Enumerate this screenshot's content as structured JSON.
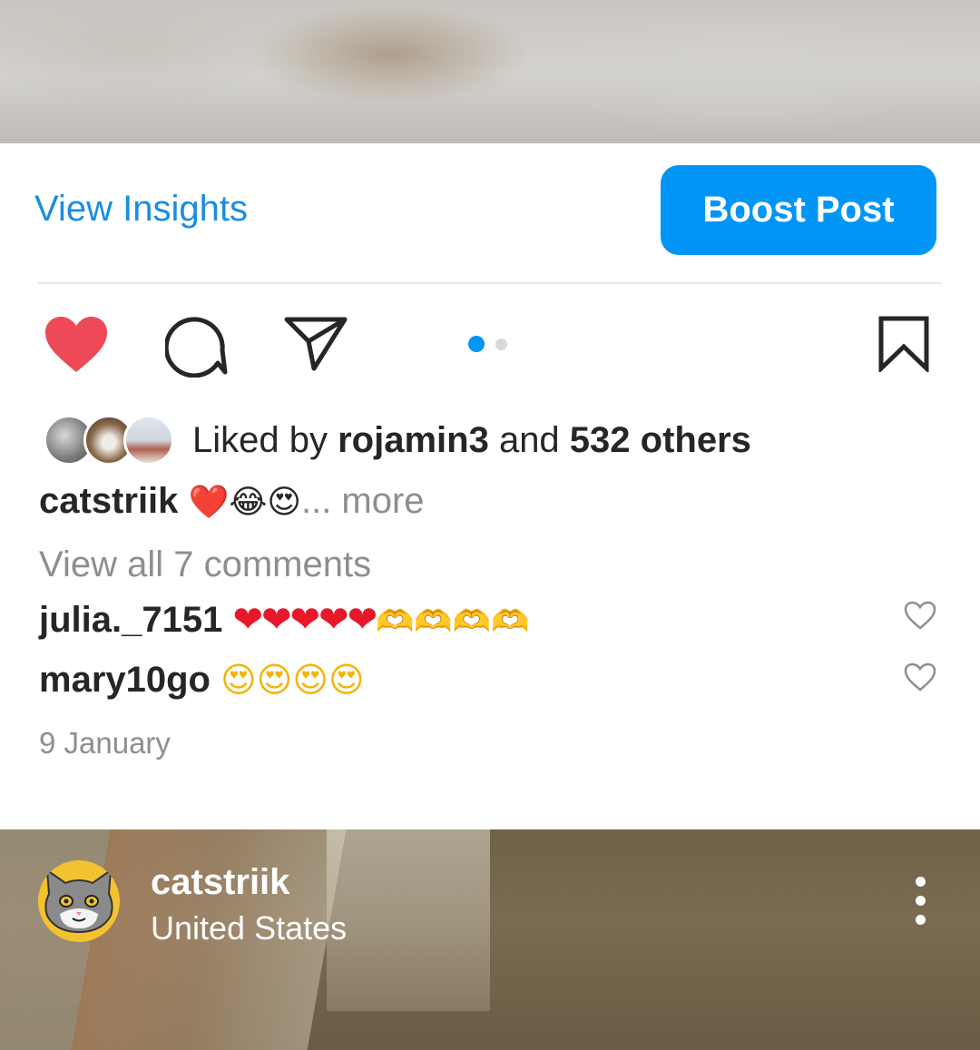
{
  "post": {
    "insights_label": "View Insights",
    "boost_label": "Boost Post",
    "carousel": {
      "count": 2,
      "active": 1
    },
    "likes": {
      "prefix": "Liked by ",
      "user": "rojamin3",
      "middle": " and ",
      "others": "532 others"
    },
    "caption": {
      "user": "catstriik",
      "emojis": "❤️😂😍",
      "more": "... more"
    },
    "view_all_comments": "View all 7 comments",
    "comments": [
      {
        "user": "julia._7151",
        "hearts": "❤❤❤❤❤",
        "hands": "🫶🫶🫶🫶"
      },
      {
        "user": "mary10go",
        "emojis": "😍😍😍😍"
      }
    ],
    "date": "9 January"
  },
  "next_post": {
    "user": "catstriik",
    "location": "United States"
  },
  "colors": {
    "accent": "#0095f6",
    "like": "#ed4956",
    "muted": "#8e8e8e"
  },
  "icons": [
    "heart-icon",
    "comment-icon",
    "share-icon",
    "bookmark-icon",
    "more-vertical-icon"
  ]
}
